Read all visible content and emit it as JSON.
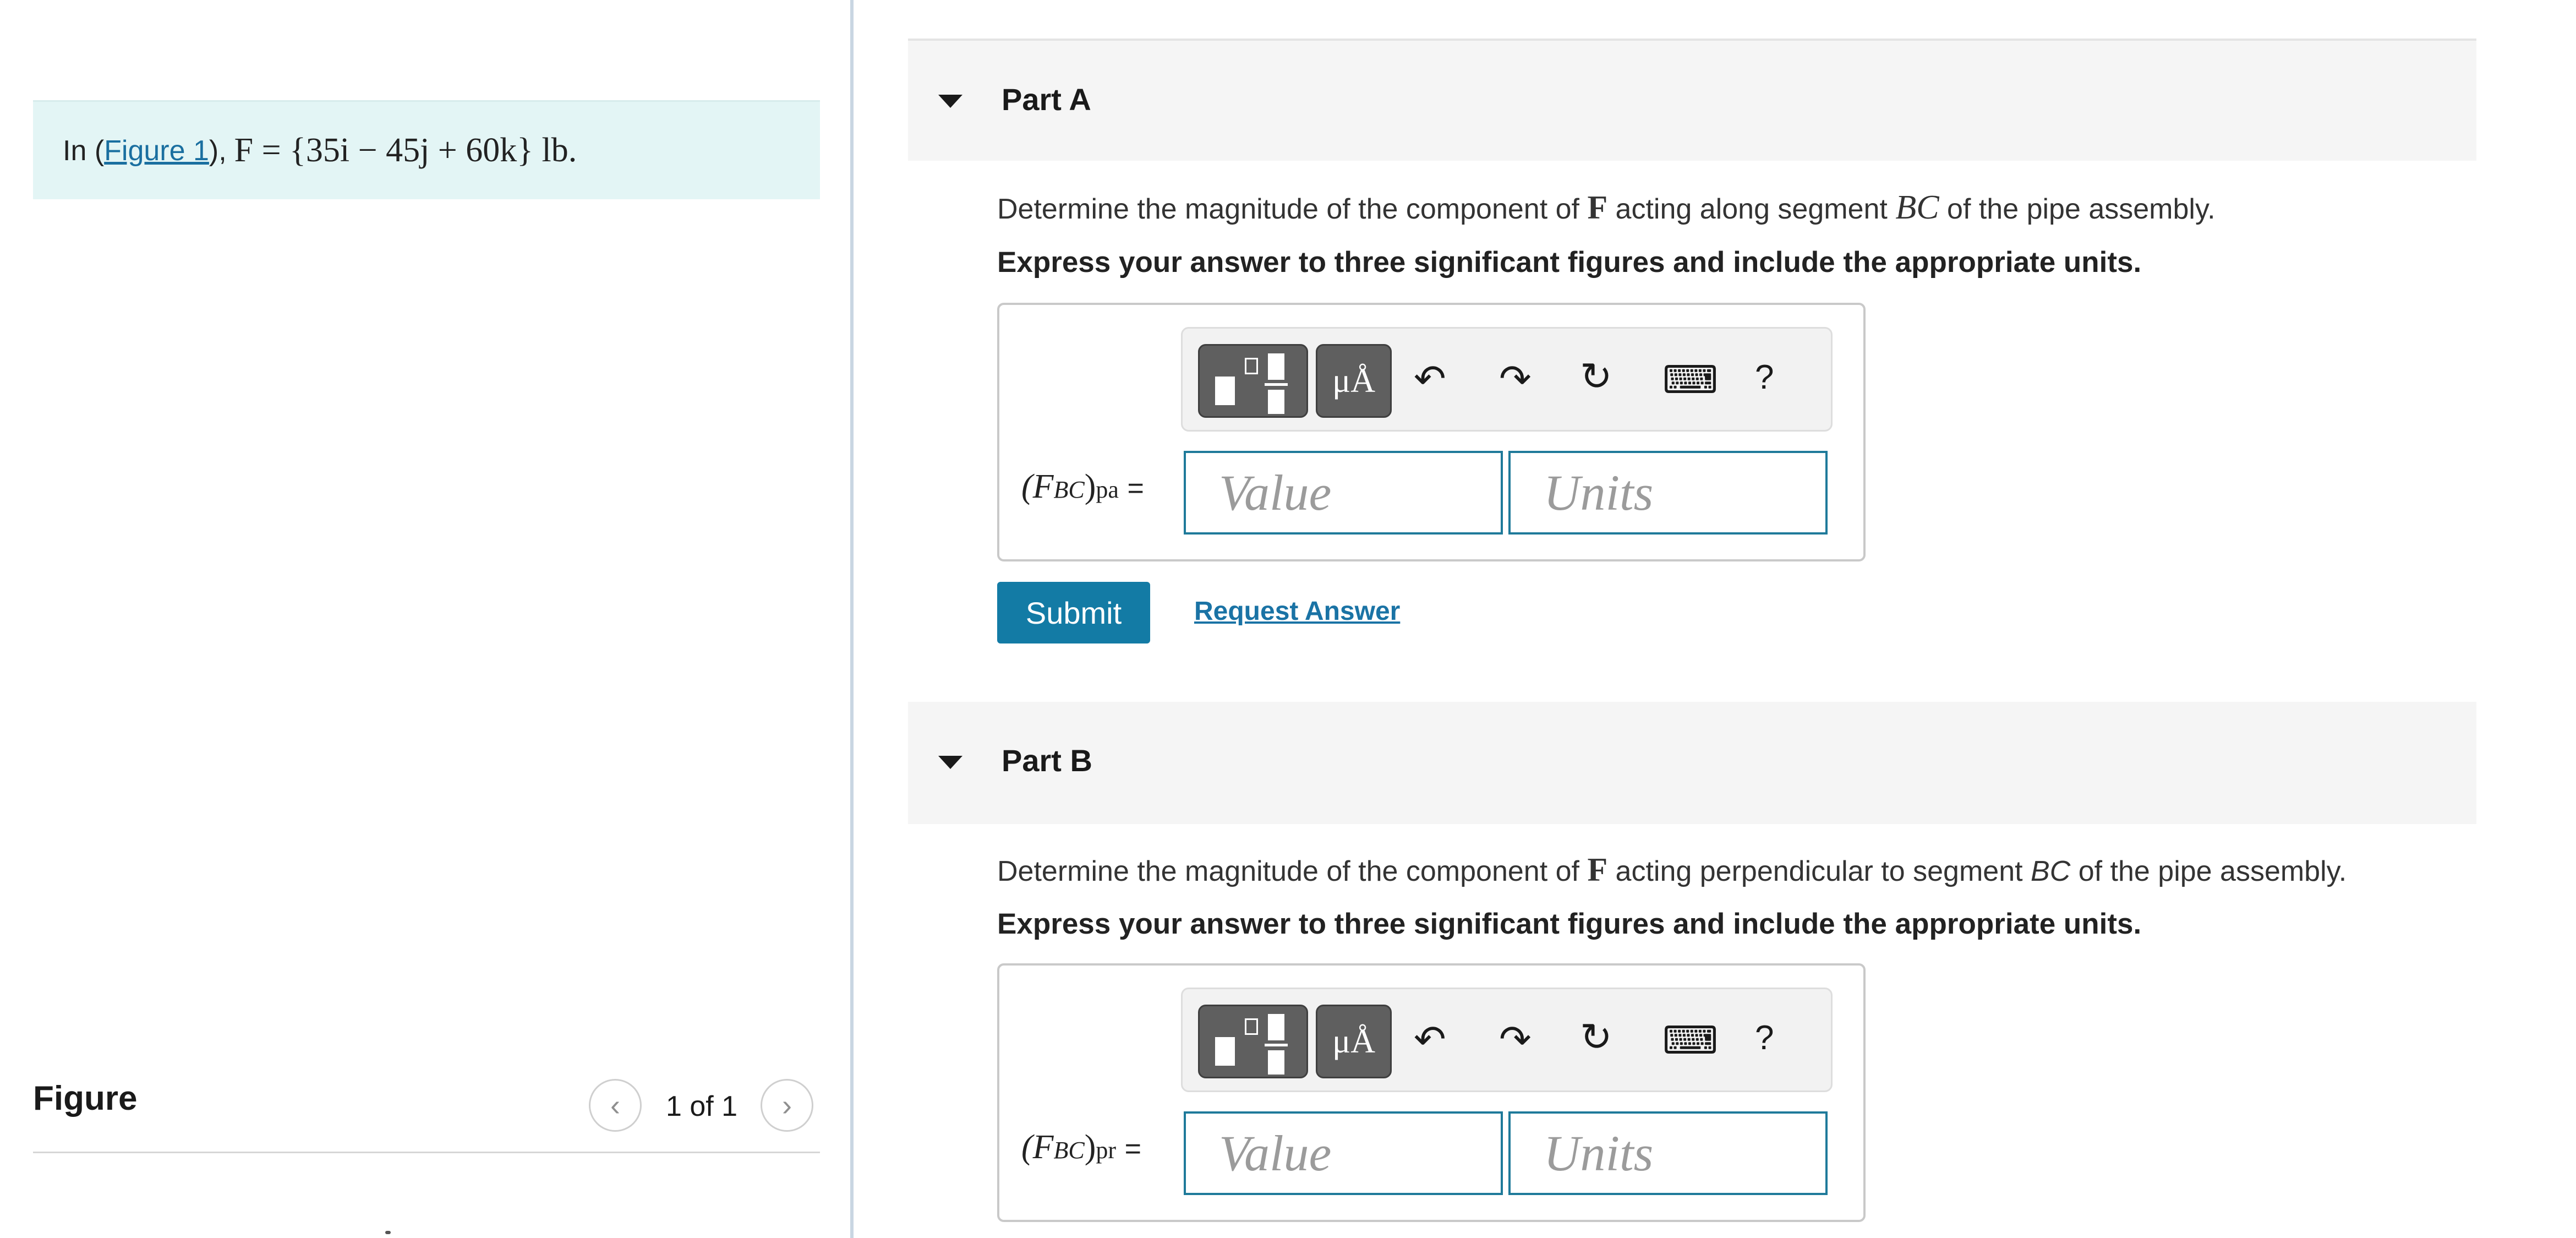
{
  "intro": {
    "prefix": "In (",
    "figure_link": "Figure 1",
    "suffix": "),",
    "force_expression": "F = {35i − 45j + 60k} lb."
  },
  "figure": {
    "title": "Figure",
    "counter": "1 of 1",
    "prev_glyph": "‹",
    "next_glyph": "›"
  },
  "partA": {
    "title": "Part A",
    "question_prefix": "Determine the magnitude of the component of",
    "question_symbol": "F",
    "question_middle": "acting along segment",
    "question_segment": "BC",
    "question_suffix": "of the pipe assembly.",
    "instruction": "Express your answer to three significant figures and include the appropriate units.",
    "label_main": "(F",
    "label_sub": "BC",
    "label_close": ")",
    "label_subscript2": "pa",
    "label_eq": "=",
    "value_placeholder": "Value",
    "units_placeholder": "Units",
    "submit_label": "Submit",
    "request_answer_label": "Request Answer"
  },
  "partB": {
    "title": "Part B",
    "question_prefix": "Determine the magnitude of the component of",
    "question_symbol": "F",
    "question_middle": "acting perpendicular to segment",
    "question_segment": "BC",
    "question_suffix": "of the pipe assembly.",
    "instruction": "Express your answer to three significant figures and include the appropriate units.",
    "label_main": "(F",
    "label_sub": "BC",
    "label_close": ")",
    "label_subscript2": "pr",
    "label_eq": "=",
    "value_placeholder": "Value",
    "units_placeholder": "Units"
  },
  "toolbar": {
    "units_label": "μÅ",
    "undo_glyph": "↶",
    "redo_glyph": "↷",
    "reset_glyph": "↻",
    "keyboard_glyph": "⌨",
    "help_label": "?"
  },
  "colors": {
    "intro_bg": "#e3f5f5",
    "accent": "#137ba5",
    "input_border": "#1f7a9a",
    "toolbar_button": "#5f5f5f"
  }
}
